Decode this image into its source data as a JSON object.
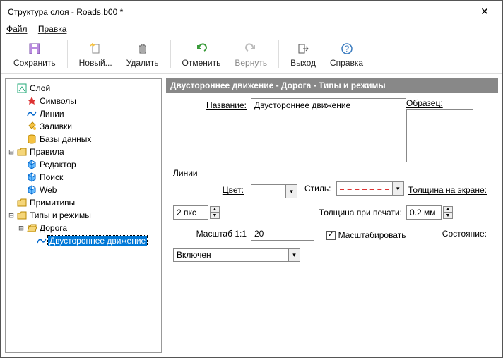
{
  "window": {
    "title": "Структура слоя - Roads.b00 *"
  },
  "menu": {
    "file": "Файл",
    "edit": "Правка"
  },
  "toolbar": {
    "save": "Сохранить",
    "new": "Новый...",
    "delete": "Удалить",
    "undo": "Отменить",
    "redo": "Вернуть",
    "exit": "Выход",
    "help": "Справка"
  },
  "tree": {
    "root": "Слой",
    "symbols": "Символы",
    "lines": "Линии",
    "fills": "Заливки",
    "db": "Базы данных",
    "rules": "Правила",
    "editor": "Редактор",
    "search": "Поиск",
    "web": "Web",
    "primitives": "Примитивы",
    "types": "Типы и режимы",
    "road": "Дорога",
    "twoway": "Двустороннее движение"
  },
  "panel": {
    "header": "Двустороннее движение - Дорога - Типы и режимы",
    "name_label": "Название:",
    "name_value": "Двустороннее движение",
    "sample_label": "Образец:",
    "lines_group": "Линии",
    "color_label": "Цвет:",
    "style_label": "Стиль:",
    "screen_thickness_label": "Толщина на экране:",
    "screen_thickness_value": "2 пкс",
    "print_thickness_label": "Толщина при печати:",
    "print_thickness_value": "0.2 мм",
    "scale_label": "Масштаб 1:1",
    "scale_value": "20",
    "scale_checkbox": "Масштабировать",
    "scale_checked": "✓",
    "state_label": "Состояние:",
    "state_value": "Включен"
  }
}
